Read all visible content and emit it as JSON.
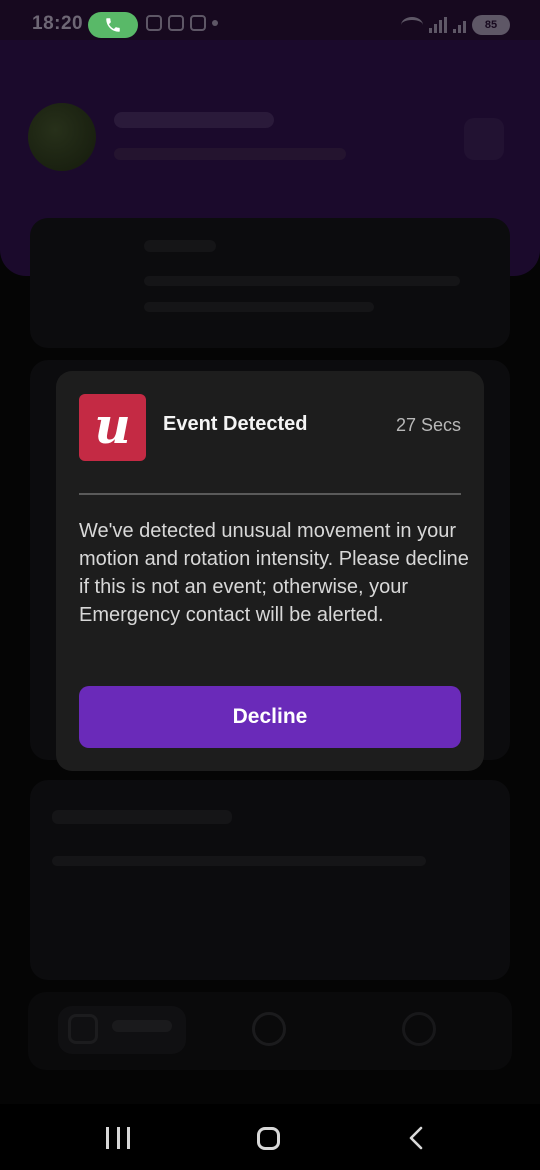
{
  "status_bar": {
    "time": "18:20",
    "battery": "85"
  },
  "modal": {
    "app_logo_letter": "u",
    "title": "Event Detected",
    "timer": "27 Secs",
    "message": "We've detected unusual movement in your motion and rotation intensity. Please decline if this is not an event; otherwise, your Emergency contact will be alerted.",
    "decline_label": "Decline"
  },
  "colors": {
    "accent": "#6a2ab9",
    "logo": "#c42a44",
    "modal_bg": "#1d1d1d",
    "call_pill": "#59b968"
  },
  "icons": {
    "call": "phone-icon",
    "wifi": "wifi-icon",
    "signal": "signal-icon",
    "battery": "battery-icon",
    "recent": "recent-apps-icon",
    "home": "home-icon",
    "back": "back-icon"
  }
}
